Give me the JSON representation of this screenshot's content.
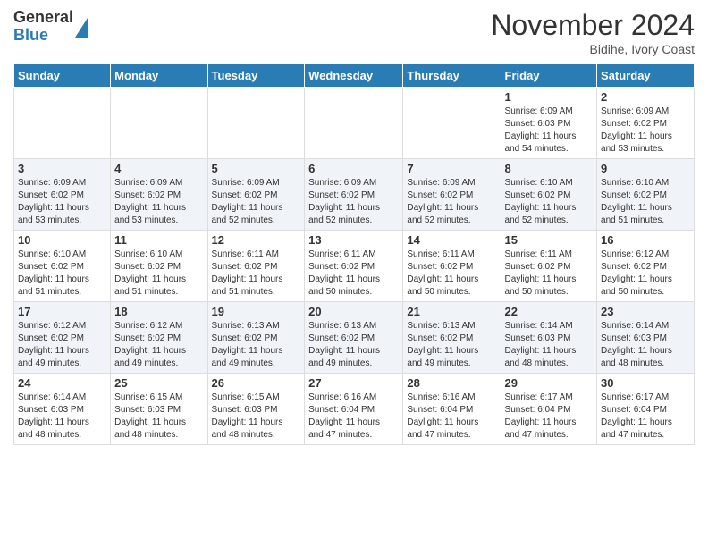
{
  "header": {
    "logo_general": "General",
    "logo_blue": "Blue",
    "month_title": "November 2024",
    "location": "Bidihe, Ivory Coast"
  },
  "days_of_week": [
    "Sunday",
    "Monday",
    "Tuesday",
    "Wednesday",
    "Thursday",
    "Friday",
    "Saturday"
  ],
  "weeks": [
    [
      {
        "num": "",
        "info": ""
      },
      {
        "num": "",
        "info": ""
      },
      {
        "num": "",
        "info": ""
      },
      {
        "num": "",
        "info": ""
      },
      {
        "num": "",
        "info": ""
      },
      {
        "num": "1",
        "info": "Sunrise: 6:09 AM\nSunset: 6:03 PM\nDaylight: 11 hours\nand 54 minutes."
      },
      {
        "num": "2",
        "info": "Sunrise: 6:09 AM\nSunset: 6:02 PM\nDaylight: 11 hours\nand 53 minutes."
      }
    ],
    [
      {
        "num": "3",
        "info": "Sunrise: 6:09 AM\nSunset: 6:02 PM\nDaylight: 11 hours\nand 53 minutes."
      },
      {
        "num": "4",
        "info": "Sunrise: 6:09 AM\nSunset: 6:02 PM\nDaylight: 11 hours\nand 53 minutes."
      },
      {
        "num": "5",
        "info": "Sunrise: 6:09 AM\nSunset: 6:02 PM\nDaylight: 11 hours\nand 52 minutes."
      },
      {
        "num": "6",
        "info": "Sunrise: 6:09 AM\nSunset: 6:02 PM\nDaylight: 11 hours\nand 52 minutes."
      },
      {
        "num": "7",
        "info": "Sunrise: 6:09 AM\nSunset: 6:02 PM\nDaylight: 11 hours\nand 52 minutes."
      },
      {
        "num": "8",
        "info": "Sunrise: 6:10 AM\nSunset: 6:02 PM\nDaylight: 11 hours\nand 52 minutes."
      },
      {
        "num": "9",
        "info": "Sunrise: 6:10 AM\nSunset: 6:02 PM\nDaylight: 11 hours\nand 51 minutes."
      }
    ],
    [
      {
        "num": "10",
        "info": "Sunrise: 6:10 AM\nSunset: 6:02 PM\nDaylight: 11 hours\nand 51 minutes."
      },
      {
        "num": "11",
        "info": "Sunrise: 6:10 AM\nSunset: 6:02 PM\nDaylight: 11 hours\nand 51 minutes."
      },
      {
        "num": "12",
        "info": "Sunrise: 6:11 AM\nSunset: 6:02 PM\nDaylight: 11 hours\nand 51 minutes."
      },
      {
        "num": "13",
        "info": "Sunrise: 6:11 AM\nSunset: 6:02 PM\nDaylight: 11 hours\nand 50 minutes."
      },
      {
        "num": "14",
        "info": "Sunrise: 6:11 AM\nSunset: 6:02 PM\nDaylight: 11 hours\nand 50 minutes."
      },
      {
        "num": "15",
        "info": "Sunrise: 6:11 AM\nSunset: 6:02 PM\nDaylight: 11 hours\nand 50 minutes."
      },
      {
        "num": "16",
        "info": "Sunrise: 6:12 AM\nSunset: 6:02 PM\nDaylight: 11 hours\nand 50 minutes."
      }
    ],
    [
      {
        "num": "17",
        "info": "Sunrise: 6:12 AM\nSunset: 6:02 PM\nDaylight: 11 hours\nand 49 minutes."
      },
      {
        "num": "18",
        "info": "Sunrise: 6:12 AM\nSunset: 6:02 PM\nDaylight: 11 hours\nand 49 minutes."
      },
      {
        "num": "19",
        "info": "Sunrise: 6:13 AM\nSunset: 6:02 PM\nDaylight: 11 hours\nand 49 minutes."
      },
      {
        "num": "20",
        "info": "Sunrise: 6:13 AM\nSunset: 6:02 PM\nDaylight: 11 hours\nand 49 minutes."
      },
      {
        "num": "21",
        "info": "Sunrise: 6:13 AM\nSunset: 6:02 PM\nDaylight: 11 hours\nand 49 minutes."
      },
      {
        "num": "22",
        "info": "Sunrise: 6:14 AM\nSunset: 6:03 PM\nDaylight: 11 hours\nand 48 minutes."
      },
      {
        "num": "23",
        "info": "Sunrise: 6:14 AM\nSunset: 6:03 PM\nDaylight: 11 hours\nand 48 minutes."
      }
    ],
    [
      {
        "num": "24",
        "info": "Sunrise: 6:14 AM\nSunset: 6:03 PM\nDaylight: 11 hours\nand 48 minutes."
      },
      {
        "num": "25",
        "info": "Sunrise: 6:15 AM\nSunset: 6:03 PM\nDaylight: 11 hours\nand 48 minutes."
      },
      {
        "num": "26",
        "info": "Sunrise: 6:15 AM\nSunset: 6:03 PM\nDaylight: 11 hours\nand 48 minutes."
      },
      {
        "num": "27",
        "info": "Sunrise: 6:16 AM\nSunset: 6:04 PM\nDaylight: 11 hours\nand 47 minutes."
      },
      {
        "num": "28",
        "info": "Sunrise: 6:16 AM\nSunset: 6:04 PM\nDaylight: 11 hours\nand 47 minutes."
      },
      {
        "num": "29",
        "info": "Sunrise: 6:17 AM\nSunset: 6:04 PM\nDaylight: 11 hours\nand 47 minutes."
      },
      {
        "num": "30",
        "info": "Sunrise: 6:17 AM\nSunset: 6:04 PM\nDaylight: 11 hours\nand 47 minutes."
      }
    ]
  ]
}
